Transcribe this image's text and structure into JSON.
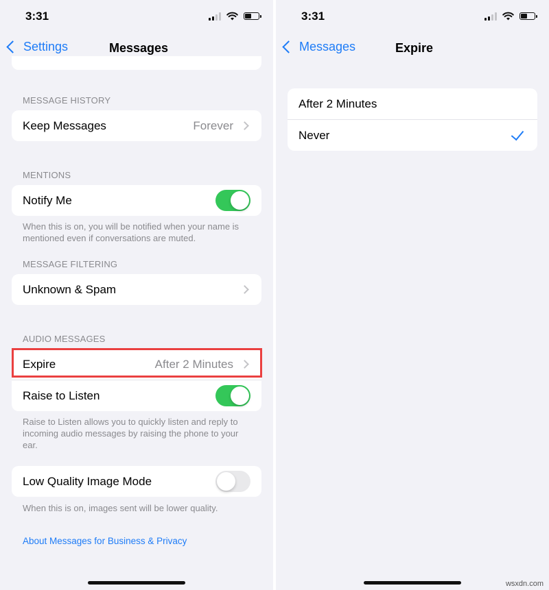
{
  "status": {
    "time": "3:31"
  },
  "left": {
    "nav": {
      "back": "Settings",
      "title": "Messages"
    },
    "message_history": {
      "label": "MESSAGE HISTORY",
      "keep_messages": {
        "label": "Keep Messages",
        "value": "Forever"
      }
    },
    "mentions": {
      "label": "MENTIONS",
      "notify_me": {
        "label": "Notify Me",
        "state": "on"
      },
      "note": "When this is on, you will be notified when your name is mentioned even if conversations are muted."
    },
    "message_filtering": {
      "label": "MESSAGE FILTERING",
      "unknown_spam": {
        "label": "Unknown & Spam"
      }
    },
    "audio_messages": {
      "label": "AUDIO MESSAGES",
      "expire": {
        "label": "Expire",
        "value": "After 2 Minutes"
      },
      "raise_to_listen": {
        "label": "Raise to Listen",
        "state": "on"
      },
      "note": "Raise to Listen allows you to quickly listen and reply to incoming audio messages by raising the phone to your ear."
    },
    "low_quality": {
      "label": "Low Quality Image Mode",
      "state": "off",
      "note": "When this is on, images sent will be lower quality."
    },
    "about_link": "About Messages for Business & Privacy"
  },
  "right": {
    "nav": {
      "back": "Messages",
      "title": "Expire"
    },
    "options": [
      {
        "label": "After 2 Minutes",
        "selected": false
      },
      {
        "label": "Never",
        "selected": true
      }
    ]
  },
  "watermark": "wsxdn.com",
  "colors": {
    "accent": "#1e7cf7",
    "toggle_on": "#34c759",
    "highlight": "#ea4040"
  }
}
